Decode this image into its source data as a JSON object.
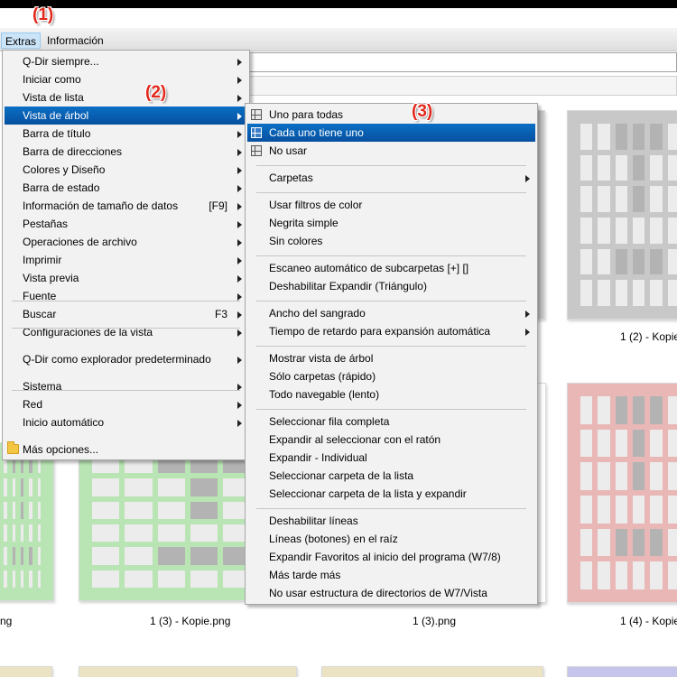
{
  "menubar": {
    "extras": "Extras",
    "informacion": "Información"
  },
  "markers": [
    "(1)",
    "(2)",
    "(3)"
  ],
  "main_menu": {
    "items": [
      {
        "label": "Q-Dir siempre...",
        "key": "",
        "arrow": true
      },
      {
        "label": "Iniciar como",
        "key": "",
        "arrow": true
      },
      {
        "label": "Vista de lista",
        "key": "",
        "arrow": true
      },
      {
        "label": "Vista de árbol",
        "key": "",
        "arrow": true
      },
      {
        "label": "Barra de título",
        "key": "",
        "arrow": true
      },
      {
        "label": "Barra de direcciones",
        "key": "",
        "arrow": true
      },
      {
        "label": "Colores y Diseño",
        "key": "",
        "arrow": true
      },
      {
        "label": "Barra de estado",
        "key": "",
        "arrow": true
      },
      {
        "label": "Información de tamaño de datos",
        "key": "[F9]",
        "arrow": true
      },
      {
        "label": "Pestañas",
        "key": "",
        "arrow": true
      },
      {
        "label": "Operaciones de archivo",
        "key": "",
        "arrow": true
      },
      {
        "label": "Imprimir",
        "key": "",
        "arrow": true
      },
      {
        "label": "Vista previa",
        "key": "",
        "arrow": true
      },
      {
        "label": "Fuente",
        "key": "",
        "arrow": true
      },
      {
        "label": "Buscar",
        "key": "F3",
        "arrow": true
      },
      {
        "label": "Configuraciones de la vista",
        "key": "",
        "arrow": true
      },
      {
        "label": "Q-Dir como explorador predeterminado",
        "key": "",
        "arrow": true
      },
      {
        "label": "Sistema",
        "key": "",
        "arrow": true
      },
      {
        "label": "Red",
        "key": "",
        "arrow": true
      },
      {
        "label": "Inicio automático",
        "key": "",
        "arrow": true
      },
      {
        "label": "Más opciones...",
        "key": "",
        "arrow": false
      }
    ]
  },
  "sub_menu": {
    "items": [
      {
        "label": "Uno para todas",
        "arrow": false,
        "icon": "grid-icon"
      },
      {
        "label": "Cada uno tiene uno",
        "arrow": false,
        "icon": "grid-icon"
      },
      {
        "label": "No usar",
        "arrow": false,
        "icon": "grid-icon"
      },
      {
        "label": "Carpetas",
        "arrow": true
      },
      {
        "label": "Usar filtros de color",
        "arrow": false
      },
      {
        "label": "Negrita simple",
        "arrow": false
      },
      {
        "label": "Sin colores",
        "arrow": false
      },
      {
        "label": "Escaneo automático de subcarpetas [+] []",
        "arrow": false
      },
      {
        "label": "Deshabilitar Expandir (Triángulo)",
        "arrow": false
      },
      {
        "label": "Ancho del sangrado",
        "arrow": true
      },
      {
        "label": "Tiempo de retardo para expansión automática",
        "arrow": true
      },
      {
        "label": "Mostrar vista de árbol",
        "arrow": false
      },
      {
        "label": "Sólo carpetas (rápido)",
        "arrow": false
      },
      {
        "label": "Todo navegable (lento)",
        "arrow": false
      },
      {
        "label": "Seleccionar fila completa",
        "arrow": false
      },
      {
        "label": "Expandir al seleccionar con el ratón",
        "arrow": false
      },
      {
        "label": "Expandir - Individual",
        "arrow": false
      },
      {
        "label": "Seleccionar carpeta de la lista",
        "arrow": false
      },
      {
        "label": "Seleccionar carpeta de la lista y expandir",
        "arrow": false
      },
      {
        "label": "Deshabilitar líneas",
        "arrow": false
      },
      {
        "label": "Líneas (botones) en el raíz",
        "arrow": false
      },
      {
        "label": "Expandir Favoritos al inicio del programa (W7/8)",
        "arrow": false
      },
      {
        "label": "Más tarde más",
        "arrow": false
      },
      {
        "label": "No usar estructura de directorios de W7/Vista",
        "arrow": false
      }
    ]
  },
  "thumbnails": {
    "captions": [
      "1 (2) - Kopie",
      "ng",
      "1 (3) - Kopie.png",
      "1 (3).png",
      "1 (4) - Kopie"
    ],
    "colors": {
      "gray": "#c8c8c8",
      "green": "#b9e4b4",
      "pink": "#eab7b7",
      "beige": "#ece3c4",
      "lavender": "#c5c5ec"
    }
  }
}
